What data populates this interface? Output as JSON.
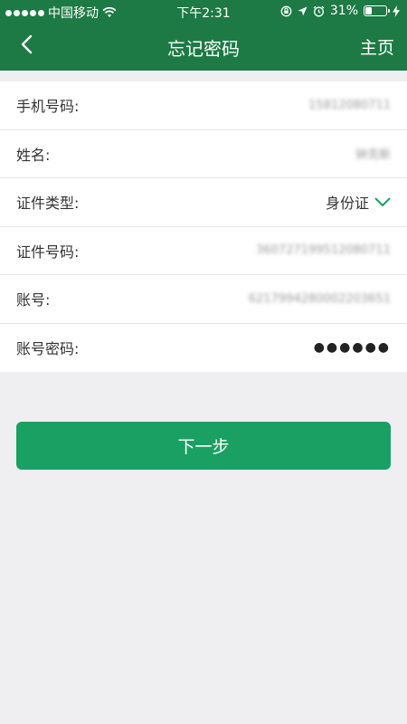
{
  "status_bar": {
    "carrier": "中国移动",
    "time": "下午2:31",
    "battery_percent": "31%",
    "battery_level": 0.31
  },
  "nav": {
    "title": "忘记密码",
    "home_label": "主页"
  },
  "form": {
    "rows": [
      {
        "label": "手机号码:",
        "value": "15812080711"
      },
      {
        "label": "姓名:",
        "value": "钟克新"
      },
      {
        "label": "证件类型:",
        "value": "身份证"
      },
      {
        "label": "证件号码:",
        "value": "360727199512080711"
      },
      {
        "label": "账号:",
        "value": "6217994280002203651"
      },
      {
        "label": "账号密码:",
        "value": "●●●●●●"
      }
    ]
  },
  "actions": {
    "next_label": "下一步"
  },
  "colors": {
    "header": "#1e7a44",
    "primary_button": "#1aa063",
    "background": "#efeff2"
  }
}
